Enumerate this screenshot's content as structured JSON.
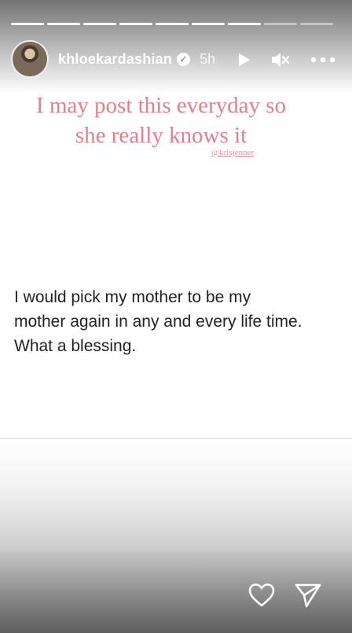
{
  "story": {
    "segments_total": 9,
    "segments_viewed": 7
  },
  "header": {
    "username": "khloekardashian",
    "time": "5h",
    "icons": [
      "avatar",
      "verified-badge-icon",
      "play-icon",
      "mute-icon",
      "more-icon"
    ]
  },
  "post": {
    "title_line1": "I may post this everyday so",
    "title_line2": "she really knows it",
    "credit": "@krisjenner",
    "body_line1": "I would pick my mother to be my",
    "body_line2": "mother again in any and every life time.",
    "body_line3": "What a blessing."
  },
  "footer": {
    "icons": [
      "heart-icon",
      "send-icon"
    ]
  },
  "colors": {
    "title": "#e57f8c",
    "credit": "#e49aa5",
    "body": "#222222",
    "overlay": "#000000"
  }
}
